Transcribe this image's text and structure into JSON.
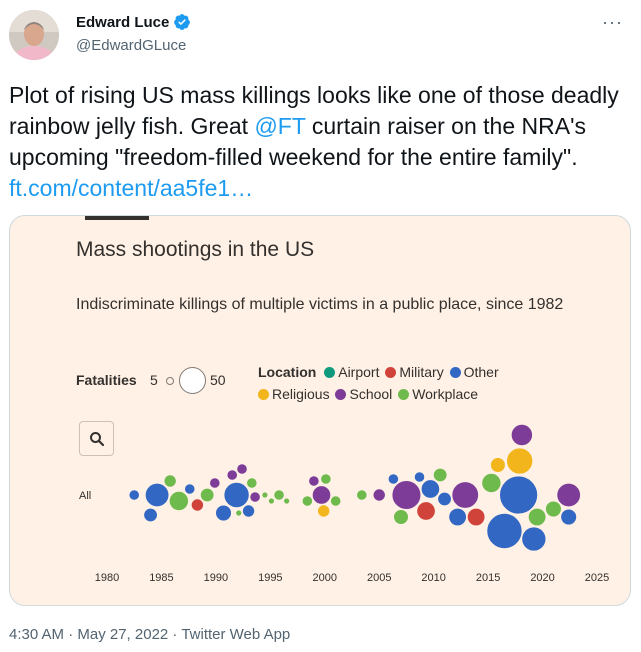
{
  "tweet": {
    "author_name": "Edward Luce",
    "author_handle": "@EdwardGLuce",
    "text_part1": "Plot of rising US mass killings looks like one of those deadly rainbow jelly fish. Great ",
    "mention": "@FT",
    "text_part2": " curtain raiser on the NRA's upcoming \"freedom-filled weekend for the entire family\". ",
    "link": "ft.com/content/aa5fe1…",
    "timestamp": "4:30 AM · May 27, 2022 · Twitter Web App"
  },
  "chart": {
    "title": "Mass shootings in the US",
    "subtitle": "Indiscriminate killings of multiple victims in a public place, since 1982",
    "fatalities_label": "Fatalities",
    "fatalities_min": "5",
    "fatalities_max": "50",
    "legend_title": "Location",
    "legend": [
      {
        "label": "Airport",
        "color": "#0f9a7e"
      },
      {
        "label": "Military",
        "color": "#d0433b"
      },
      {
        "label": "Other",
        "color": "#3268c4"
      },
      {
        "label": "Religious",
        "color": "#f2b61c"
      },
      {
        "label": "School",
        "color": "#7d3c98"
      },
      {
        "label": "Workplace",
        "color": "#6fba4c"
      }
    ],
    "row_label": "All"
  },
  "chart_data": {
    "type": "scatter",
    "title": "Mass shootings in the US",
    "subtitle": "Indiscriminate killings of multiple victims in a public place, since 1982",
    "x_ticks": [
      "1980",
      "1985",
      "1990",
      "1995",
      "2000",
      "2005",
      "2010",
      "2015",
      "2020",
      "2025"
    ],
    "xlim": [
      1980,
      2025
    ],
    "points": [
      {
        "x": 1982.5,
        "fatalities": 6,
        "location": "Other"
      },
      {
        "x": 1984.0,
        "fatalities": 8,
        "location": "Other"
      },
      {
        "x": 1984.6,
        "fatalities": 21,
        "location": "Other"
      },
      {
        "x": 1985.8,
        "fatalities": 7,
        "location": "Workplace"
      },
      {
        "x": 1986.6,
        "fatalities": 14,
        "location": "Workplace"
      },
      {
        "x": 1987.6,
        "fatalities": 6,
        "location": "Other"
      },
      {
        "x": 1988.3,
        "fatalities": 7,
        "location": "Military"
      },
      {
        "x": 1989.2,
        "fatalities": 8,
        "location": "Workplace"
      },
      {
        "x": 1989.9,
        "fatalities": 6,
        "location": "School"
      },
      {
        "x": 1990.7,
        "fatalities": 10,
        "location": "Other"
      },
      {
        "x": 1991.5,
        "fatalities": 6,
        "location": "School"
      },
      {
        "x": 1991.9,
        "fatalities": 24,
        "location": "Other"
      },
      {
        "x": 1992.4,
        "fatalities": 6,
        "location": "School"
      },
      {
        "x": 1992.1,
        "fatalities": 5,
        "location": "Workplace"
      },
      {
        "x": 1993.0,
        "fatalities": 7,
        "location": "Other"
      },
      {
        "x": 1993.3,
        "fatalities": 6,
        "location": "Workplace"
      },
      {
        "x": 1993.6,
        "fatalities": 6,
        "location": "School"
      },
      {
        "x": 1994.5,
        "fatalities": 5,
        "location": "Workplace"
      },
      {
        "x": 1995.1,
        "fatalities": 5,
        "location": "Workplace"
      },
      {
        "x": 1995.8,
        "fatalities": 6,
        "location": "Workplace"
      },
      {
        "x": 1996.5,
        "fatalities": 5,
        "location": "Workplace"
      },
      {
        "x": 1998.4,
        "fatalities": 6,
        "location": "Workplace"
      },
      {
        "x": 1999.0,
        "fatalities": 6,
        "location": "School"
      },
      {
        "x": 1999.7,
        "fatalities": 13,
        "location": "School"
      },
      {
        "x": 1999.9,
        "fatalities": 7,
        "location": "Religious"
      },
      {
        "x": 2000.1,
        "fatalities": 6,
        "location": "Workplace"
      },
      {
        "x": 2001.0,
        "fatalities": 6,
        "location": "Workplace"
      },
      {
        "x": 2003.4,
        "fatalities": 6,
        "location": "Workplace"
      },
      {
        "x": 2005.0,
        "fatalities": 7,
        "location": "School"
      },
      {
        "x": 2006.3,
        "fatalities": 6,
        "location": "Other"
      },
      {
        "x": 2007.0,
        "fatalities": 9,
        "location": "Workplace"
      },
      {
        "x": 2007.5,
        "fatalities": 32,
        "location": "School"
      },
      {
        "x": 2008.7,
        "fatalities": 6,
        "location": "Other"
      },
      {
        "x": 2009.3,
        "fatalities": 13,
        "location": "Military"
      },
      {
        "x": 2009.7,
        "fatalities": 13,
        "location": "Other"
      },
      {
        "x": 2010.6,
        "fatalities": 8,
        "location": "Workplace"
      },
      {
        "x": 2011.0,
        "fatalities": 8,
        "location": "Other"
      },
      {
        "x": 2012.2,
        "fatalities": 12,
        "location": "Other"
      },
      {
        "x": 2012.9,
        "fatalities": 27,
        "location": "School"
      },
      {
        "x": 2013.9,
        "fatalities": 12,
        "location": "Military"
      },
      {
        "x": 2015.3,
        "fatalities": 14,
        "location": "Workplace"
      },
      {
        "x": 2015.9,
        "fatalities": 9,
        "location": "Religious"
      },
      {
        "x": 2016.5,
        "fatalities": 49,
        "location": "Other"
      },
      {
        "x": 2017.8,
        "fatalities": 58,
        "location": "Other"
      },
      {
        "x": 2017.9,
        "fatalities": 26,
        "location": "Religious"
      },
      {
        "x": 2018.1,
        "fatalities": 17,
        "location": "School"
      },
      {
        "x": 2019.2,
        "fatalities": 22,
        "location": "Other"
      },
      {
        "x": 2019.5,
        "fatalities": 12,
        "location": "Workplace"
      },
      {
        "x": 2021.0,
        "fatalities": 10,
        "location": "Workplace"
      },
      {
        "x": 2022.4,
        "fatalities": 21,
        "location": "School"
      },
      {
        "x": 2022.4,
        "fatalities": 10,
        "location": "Other"
      }
    ]
  }
}
